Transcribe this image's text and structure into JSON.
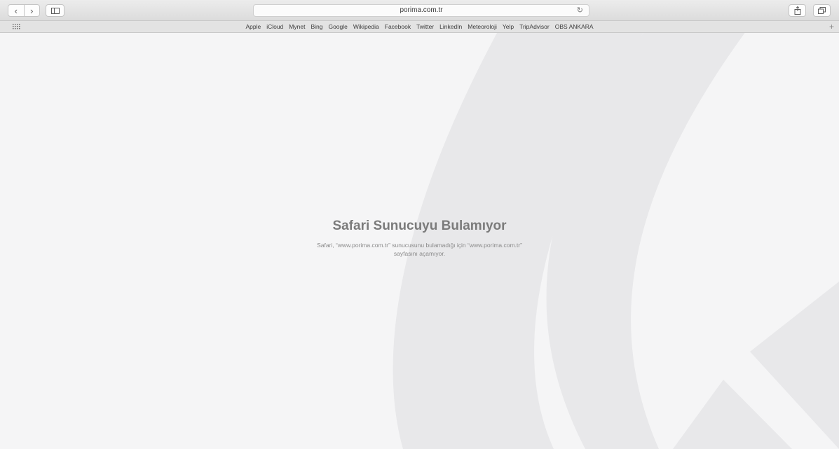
{
  "window": {
    "url": "porima.com.tr"
  },
  "toolbar": {
    "back_icon": "chevron-left-icon",
    "forward_icon": "chevron-right-icon",
    "sidebar_icon": "sidebar-icon",
    "reload_icon": "reload-icon",
    "share_icon": "share-icon",
    "tabs_icon": "tabs-icon"
  },
  "bookmarks": [
    "Apple",
    "iCloud",
    "Mynet",
    "Bing",
    "Google",
    "Wikipedia",
    "Facebook",
    "Twitter",
    "LinkedIn",
    "Meteoroloji",
    "Yelp",
    "TripAdvisor",
    "OBS ANKARA"
  ],
  "error": {
    "title": "Safari Sunucuyu Bulamıyor",
    "line1": "Safari, “www.porima.com.tr” sunucusunu bulamadığı için “www.porima.com.tr”",
    "line2": "sayfasını açamıyor."
  }
}
